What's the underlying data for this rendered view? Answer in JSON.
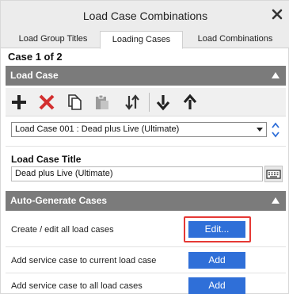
{
  "window": {
    "title": "Load Case Combinations",
    "close_icon": "close-icon"
  },
  "tabs": [
    {
      "label": "Load Group Titles",
      "active": false
    },
    {
      "label": "Loading Cases",
      "active": true
    },
    {
      "label": "Load Combinations",
      "active": false
    }
  ],
  "case_count": "Case 1 of 2",
  "load_case_section": {
    "title": "Load Case",
    "collapse_icon": "chevron-up-icon",
    "toolbar": [
      {
        "name": "add-icon",
        "color": "#222222"
      },
      {
        "name": "delete-icon",
        "color": "#d32f2f"
      },
      {
        "name": "copy-icon",
        "color": "#333333"
      },
      {
        "name": "paste-icon",
        "color": "#9a9a9a"
      },
      {
        "name": "sort-icon",
        "color": "#333333"
      },
      {
        "name": "move-down-icon",
        "color": "#222222"
      },
      {
        "name": "move-up-icon",
        "color": "#222222"
      }
    ],
    "selected_case": "Load Case 001 : Dead plus Live (Ultimate)",
    "title_label": "Load Case Title",
    "title_value": "Dead plus Live (Ultimate)"
  },
  "auto_generate_section": {
    "title": "Auto-Generate Cases",
    "rows": [
      {
        "label": "Create / edit all load cases",
        "button": "Edit..."
      },
      {
        "label": "Add service case to current load case",
        "button": "Add"
      },
      {
        "label": "Add service case to all load cases",
        "button": "Add"
      }
    ]
  },
  "colors": {
    "section_bar": "#7b7b7b",
    "primary_button": "#2f6fd8",
    "highlight": "#e53935"
  }
}
